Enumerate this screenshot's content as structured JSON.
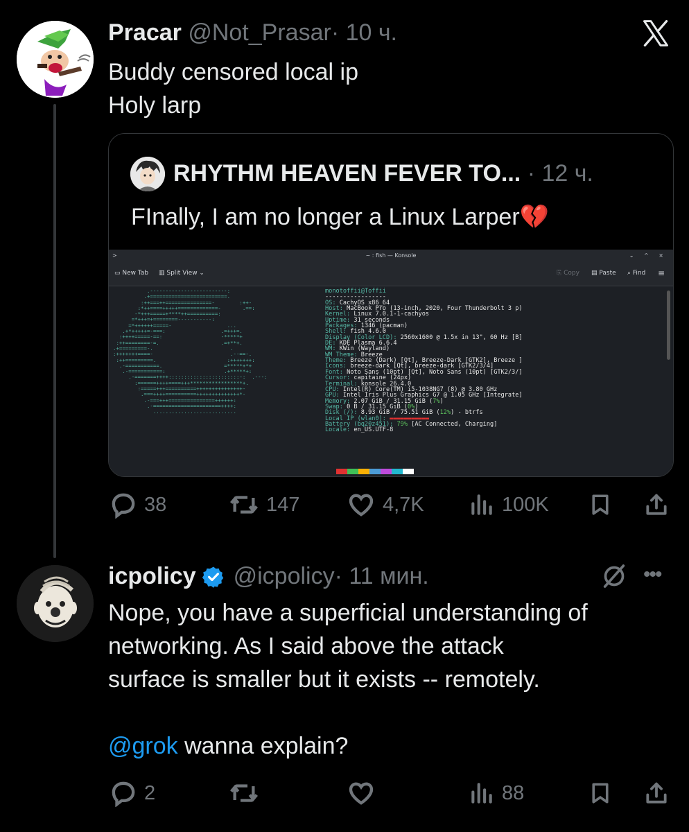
{
  "post1": {
    "display_name": "Pracar",
    "handle": "@Not_Prasar",
    "time": "· 10 ч.",
    "text_line1": "Buddy censored local ip",
    "text_line2": "Holy larp",
    "quote": {
      "display_name": "RHYTHM HEAVEN FEVER TO...",
      "time": "· 12 ч.",
      "text": "FInally, I am no longer a Linux Larper",
      "emoji": "💔",
      "screenshot": {
        "window_title": "~ : fish — Konsole",
        "new_tab": "New Tab",
        "split_view": "Split View",
        "copy": "Copy",
        "paste": "Paste",
        "find": "Find",
        "user_host": "monotoffii@Toffii",
        "separator": "-----------------",
        "os_label": "OS",
        "os_value": "CachyOS x86_64",
        "host_label": "Host",
        "host_value": "MacBook Pro (13-inch, 2020, Four Thunderbolt 3 p)",
        "kernel_label": "Kernel",
        "kernel_value": "Linux 7.0.1-1-cachyos",
        "uptime_label": "Uptime",
        "uptime_value": "31 seconds",
        "packages_label": "Packages",
        "packages_value": "1346 (pacman)",
        "shell_label": "Shell",
        "shell_value": "fish 4.6.0",
        "display_label": "Display (Color LCD)",
        "display_value": "2560x1600 @ 1.5x in 13\", 60 Hz [B]",
        "de_label": "DE",
        "de_value": "KDE Plasma 6.6.4",
        "wm_label": "WM",
        "wm_value": "KWin (Wayland)",
        "wmtheme_label": "WM Theme",
        "wmtheme_value": "Breeze",
        "theme_label": "Theme",
        "theme_value": "Breeze (Dark) [Qt], Breeze-Dark [GTK2], Breeze ]",
        "icons_label": "Icons",
        "icons_value": "breeze-dark [Qt], breeze-dark [GTK2/3/4]",
        "font_label": "Font",
        "font_value": "Noto Sans (10pt) [Qt], Noto Sans (10pt) [GTK2/3/]",
        "cursor_label": "Cursor",
        "cursor_value": "capitaine (24px)",
        "terminal_label": "Terminal",
        "terminal_value": "konsole 26.4.0",
        "cpu_label": "CPU",
        "cpu_value": "Intel(R) Core(TM) i5-1038NG7 (8) @ 3.80 GHz",
        "gpu_label": "GPU",
        "gpu_value": "Intel Iris Plus Graphics G7 @ 1.05 GHz [Integrate]",
        "memory_label": "Memory",
        "memory_value": "2.07 GiB / 31.15 GiB (",
        "memory_pct": "7%",
        "memory_end": ")",
        "swap_label": "Swap",
        "swap_value": "0 B / 31.15 GiB (",
        "swap_pct": "0%",
        "swap_end": ")",
        "disk_label": "Disk (/)",
        "disk_value": "8.93 GiB / 75.51 GiB (",
        "disk_pct": "12%",
        "disk_end": ") - btrfs",
        "localip_label": "Local IP (wlan0)",
        "battery_label": "Battery (bq20z451)",
        "battery_pct": "79%",
        "battery_value": " [AC Connected, Charging]",
        "locale_label": "Locale",
        "locale_value": "en_US.UTF-8"
      }
    },
    "stats": {
      "replies": "38",
      "reposts": "147",
      "likes": "4,7K",
      "views": "100K"
    }
  },
  "post2": {
    "display_name": "icpolicy",
    "handle": "@icpolicy",
    "time": "· 11 мин.",
    "line1": "Nope, you have a superficial understanding of",
    "line2": "networking. As I said above the attack",
    "line3": "surface is smaller but it exists -- remotely.",
    "mention": "@grok",
    "mention_rest": " wanna explain?",
    "stats": {
      "replies": "2",
      "views": "88"
    }
  },
  "colors": {
    "accent": "#1d9bf0",
    "muted": "#71767b",
    "background": "#000000",
    "verified": "#1d9bf0"
  },
  "icons": [
    "x-logo-icon",
    "reply-icon",
    "repost-icon",
    "like-icon",
    "views-icon",
    "bookmark-icon",
    "share-icon",
    "verified-icon",
    "grok-icon",
    "more-icon"
  ]
}
